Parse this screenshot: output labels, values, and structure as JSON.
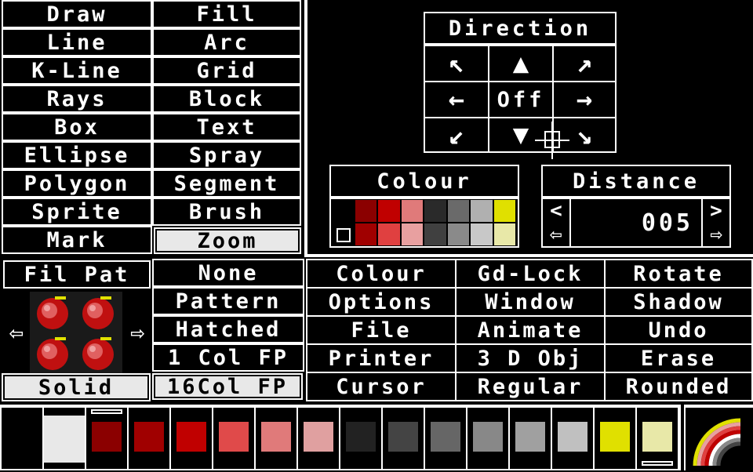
{
  "tools": {
    "left": [
      "Draw",
      "Line",
      "K-Line",
      "Rays",
      "Box",
      "Ellipse",
      "Polygon",
      "Sprite",
      "Mark"
    ],
    "right": [
      "Fill",
      "Arc",
      "Grid",
      "Block",
      "Text",
      "Spray",
      "Segment",
      "Brush",
      "Zoom"
    ],
    "selected": "Zoom"
  },
  "direction": {
    "title": "Direction",
    "center": "Off",
    "arrows": [
      "↖",
      "▲",
      "↗",
      "←",
      "→",
      "↙",
      "▼",
      "↘"
    ]
  },
  "colour_panel": {
    "title": "Colour",
    "top_row": [
      "#000000",
      "#8b0000",
      "#c00000",
      "#e07a7a",
      "#2a2a2a",
      "#6a6a6a",
      "#b0b0b0",
      "#e0e000"
    ],
    "bottom_row": [
      "#000000",
      "#a00000",
      "#e04040",
      "#e8a0a0",
      "#404040",
      "#8a8a8a",
      "#c8c8c8",
      "#e8e8a8"
    ]
  },
  "distance": {
    "title": "Distance",
    "value": "005",
    "prev": "<",
    "next": ">"
  },
  "fill_pattern": {
    "label": "Fil Pat",
    "options": [
      "None",
      "Pattern",
      "Hatched",
      "1 Col FP",
      "16Col FP"
    ],
    "solid": "Solid",
    "prev": "⇦",
    "next": "⇨"
  },
  "menu": {
    "col1": [
      "Colour",
      "Options",
      "File",
      "Printer",
      "Cursor"
    ],
    "col2": [
      "Gd-Lock",
      "Window",
      "Animate",
      "3 D Obj",
      "Regular"
    ],
    "col3": [
      "Rotate",
      "Shadow",
      "Undo",
      "Erase",
      "Rounded"
    ]
  },
  "palette": [
    "#000000",
    "#e8e8e8",
    "#8b0000",
    "#a00000",
    "#c00000",
    "#e04a4a",
    "#e07a7a",
    "#e0a0a0",
    "#222222",
    "#444444",
    "#666666",
    "#888888",
    "#a0a0a0",
    "#c0c0c0",
    "#e0e000",
    "#e8e8a8"
  ]
}
